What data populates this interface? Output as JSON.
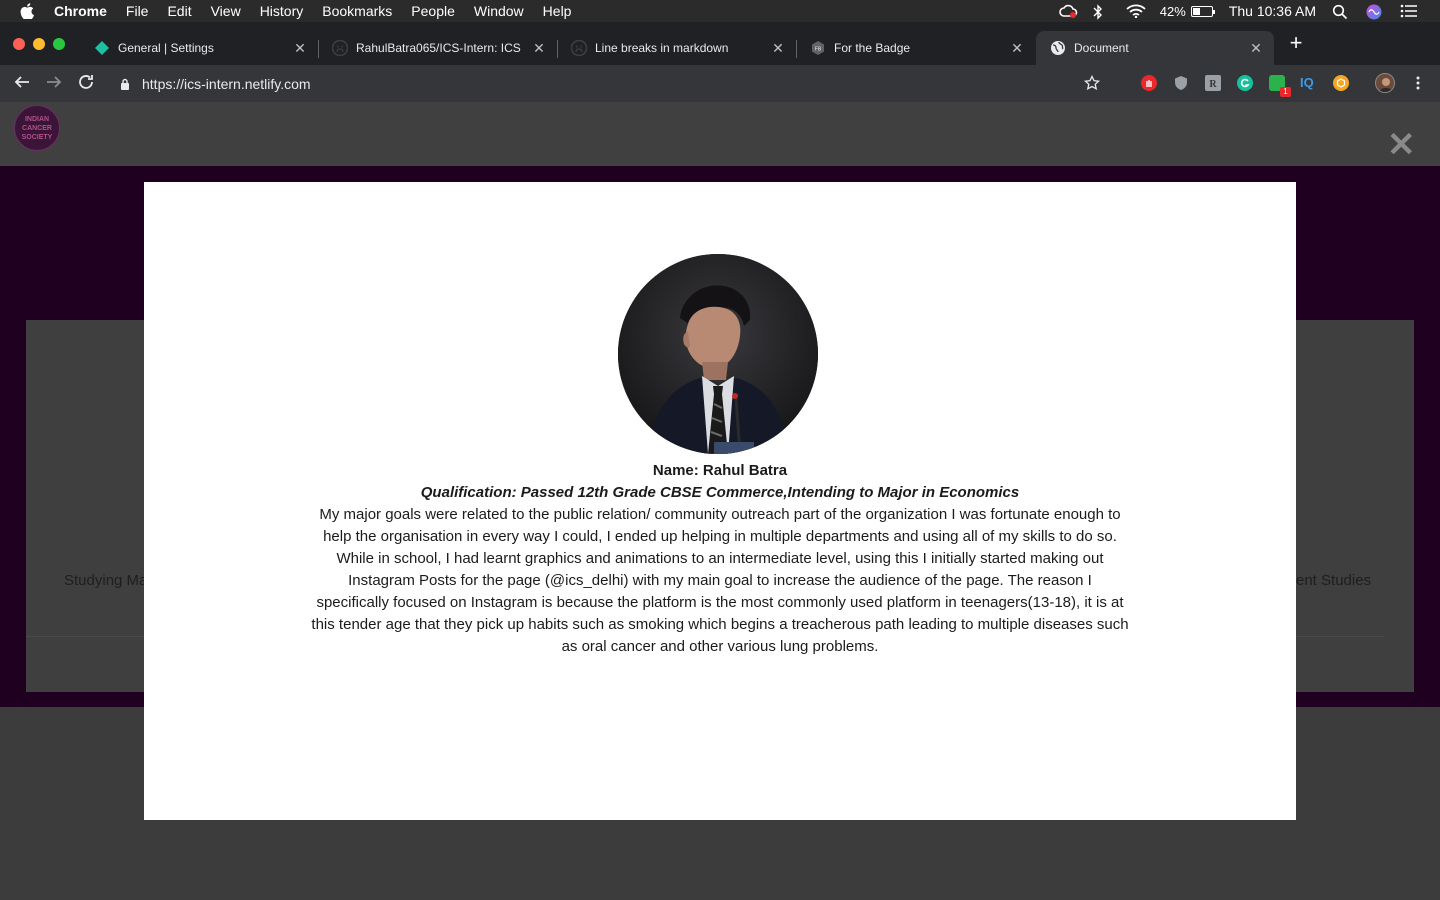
{
  "menubar": {
    "app": "Chrome",
    "items": [
      "File",
      "Edit",
      "View",
      "History",
      "Bookmarks",
      "People",
      "Window",
      "Help"
    ],
    "battery_percent": "42%",
    "battery_level": 0.42,
    "clock": "Thu 10:36 AM"
  },
  "tabs": [
    {
      "title": "General | Settings",
      "icon": "diamond-icon",
      "color": "#1dbf9f"
    },
    {
      "title": "RahulBatra065/ICS-Intern: ICS",
      "icon": "github-icon",
      "color": "#202124"
    },
    {
      "title": "Line breaks in markdown",
      "icon": "github-icon",
      "color": "#202124"
    },
    {
      "title": "For the Badge",
      "icon": "badge-icon",
      "color": "#6b6b6b"
    },
    {
      "title": "Document",
      "icon": "globe-icon",
      "color": "#e8eaed",
      "active": true
    }
  ],
  "omnibox": {
    "url": "https://ics-intern.netlify.com"
  },
  "extensions": [
    {
      "name": "adblock-icon",
      "color": "#e8282b"
    },
    {
      "name": "shield-icon",
      "color": "#9aa0a6"
    },
    {
      "name": "font-icon",
      "color": "#9aa0a6"
    },
    {
      "name": "grammarly-icon",
      "color": "#15c39a"
    },
    {
      "name": "extension-green-icon",
      "color": "#2bb24c"
    },
    {
      "name": "iq-icon",
      "color": "#3d9ae8"
    },
    {
      "name": "honey-icon",
      "color": "#f5a623"
    }
  ],
  "site": {
    "logo_text": "INDIAN CANCER SOCIETY",
    "bg_left_text": "Studying Ma",
    "bg_right_text": "ent Studies"
  },
  "modal": {
    "name": "Name: Rahul Batra",
    "qualification": "Qualification: Passed 12th Grade CBSE Commerce,Intending to Major in Economics",
    "bio": "My major goals were related to the public relation/ community outreach part of the organization I was fortunate enough to help the organisation in every way I could, I ended up helping in multiple departments and using all of my skills to do so. While in school, I had learnt graphics and animations to an intermediate level, using this I initially started making out Instagram Posts for the page (@ics_delhi) with my main goal to increase the audience of the page. The reason I specifically focused on Instagram is because the platform is the most commonly used platform in teenagers(13-18), it is at this tender age that they pick up habits such as smoking which begins a treacherous path leading to multiple diseases such as oral cancer and other various lung problems."
  }
}
